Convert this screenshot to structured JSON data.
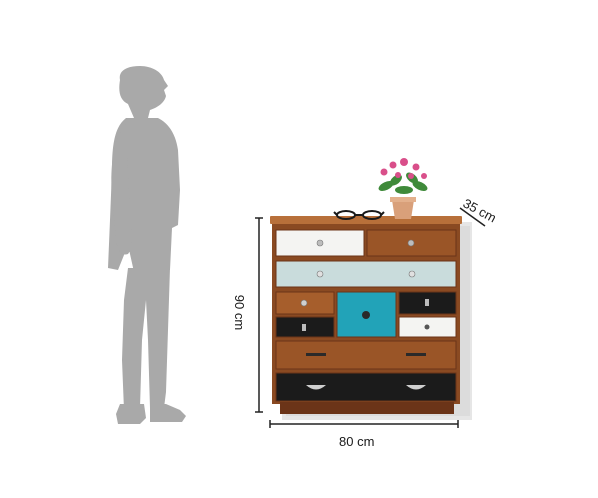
{
  "dimensions": {
    "width": "80 cm",
    "height": "90 cm",
    "depth": "35 cm"
  },
  "colors": {
    "silhouette": "#a9a9a9",
    "wood_dark": "#6b3418",
    "wood_mid": "#9a5527",
    "wood_light": "#b8703a",
    "drawer_white": "#f4f4f2",
    "drawer_pale_blue": "#c9dcdc",
    "drawer_teal": "#22a3b8",
    "drawer_black": "#1b1b1b",
    "shadow": "#d9d9d9",
    "line": "#222222"
  }
}
